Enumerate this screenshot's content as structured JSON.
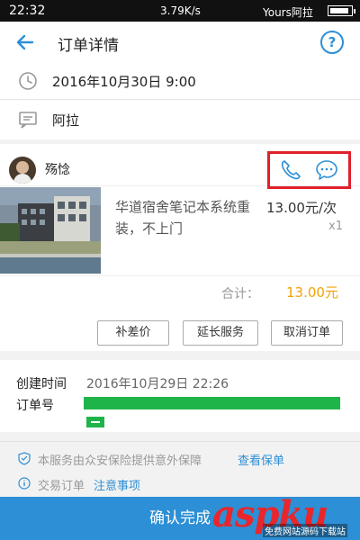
{
  "status_bar": {
    "time": "22:32",
    "speed": "3.79K/s",
    "carrier": "Yours阿拉"
  },
  "header": {
    "title": "订单详情",
    "help": "?"
  },
  "order": {
    "datetime": "2016年10月30日 9:00",
    "address": "阿拉"
  },
  "provider": {
    "name": "殇惗"
  },
  "service": {
    "title": "华道宿舍笔记本系统重装，不上门",
    "price": "13.00元/次",
    "quantity": "x1"
  },
  "total": {
    "label": "合计：",
    "value": "13.00元"
  },
  "actions": {
    "supplement": "补差价",
    "extend": "延长服务",
    "cancel": "取消订单"
  },
  "info": {
    "created_label": "创建时间",
    "created_value": "2016年10月29日 22:26",
    "order_no_label": "订单号"
  },
  "notices": {
    "insurance": "本服务由众安保险提供意外保障",
    "insurance_link": "查看保单",
    "trade": "交易订单",
    "trade_link": "注意事项"
  },
  "confirm_label": "确认完成",
  "watermark": {
    "text": "aspku",
    "sub": "免费网站源码下载站"
  },
  "colors": {
    "accent": "#2d8fd5",
    "price": "#f0a30a",
    "highlight": "#e0202a",
    "redaction": "#1fb44a"
  }
}
